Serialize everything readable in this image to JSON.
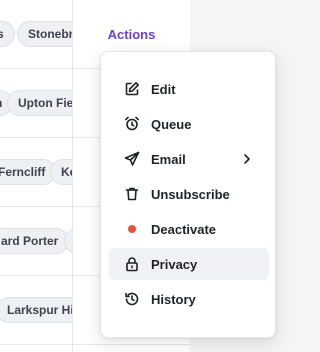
{
  "table": {
    "actions_header": "Actions",
    "rows": [
      {
        "tags": [
          "s",
          "Stonebri"
        ]
      },
      {
        "tags": [
          "n",
          "Upton Fiel"
        ]
      },
      {
        "tags": [
          "Ferncliff",
          "Ke"
        ]
      },
      {
        "tags": [
          "ard Porter",
          ""
        ]
      },
      {
        "tags": [
          "Larkspur Hil"
        ]
      }
    ]
  },
  "menu": {
    "items": [
      {
        "label": "Edit",
        "icon": "edit-icon"
      },
      {
        "label": "Queue",
        "icon": "queue-icon"
      },
      {
        "label": "Email",
        "icon": "send-icon",
        "submenu": true
      },
      {
        "label": "Unsubscribe",
        "icon": "trash-icon"
      },
      {
        "label": "Deactivate",
        "icon": "status-dot-icon",
        "dot_color": "#e5533d"
      },
      {
        "label": "Privacy",
        "icon": "lock-icon",
        "active": true
      },
      {
        "label": "History",
        "icon": "history-icon"
      }
    ]
  }
}
